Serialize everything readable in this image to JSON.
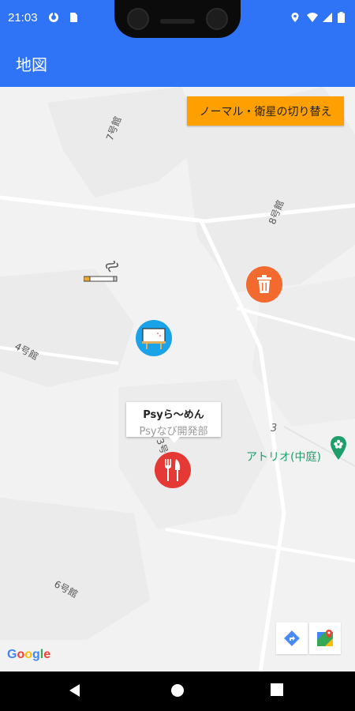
{
  "status_bar": {
    "time": "21:03",
    "icons": [
      "sync-icon",
      "sim-card-icon",
      "location-icon",
      "wifi-icon",
      "signal-icon",
      "battery-icon"
    ]
  },
  "app_bar": {
    "title": "地図"
  },
  "map": {
    "toggle_button_label": "ノーマル・衛星の切り替え",
    "building_labels": {
      "b7": "7号館",
      "b8": "8号館",
      "b4": "4号館",
      "b6": "6号館",
      "b3": "3号"
    },
    "street_number": "3",
    "info_window": {
      "title": "Psyら〜めん",
      "subtitle": "Psyなび開発部"
    },
    "poi": {
      "label": "アトリオ(中庭)"
    },
    "markers": [
      {
        "icon": "smoking-icon"
      },
      {
        "icon": "trash-can-icon",
        "color": "#f26a2e"
      },
      {
        "icon": "whiteboard-icon",
        "color": "#1aa3e8"
      },
      {
        "icon": "restaurant-icon",
        "color": "#e53935"
      }
    ],
    "google_logo": "Google",
    "tools": [
      "directions-icon",
      "google-maps-icon"
    ]
  },
  "nav_bar": {
    "buttons": [
      "back-icon",
      "home-icon",
      "recents-icon"
    ]
  },
  "colors": {
    "app_bar": "#2f73f6",
    "toggle_button": "#ffa000",
    "poi_text": "#1e9e6a"
  }
}
